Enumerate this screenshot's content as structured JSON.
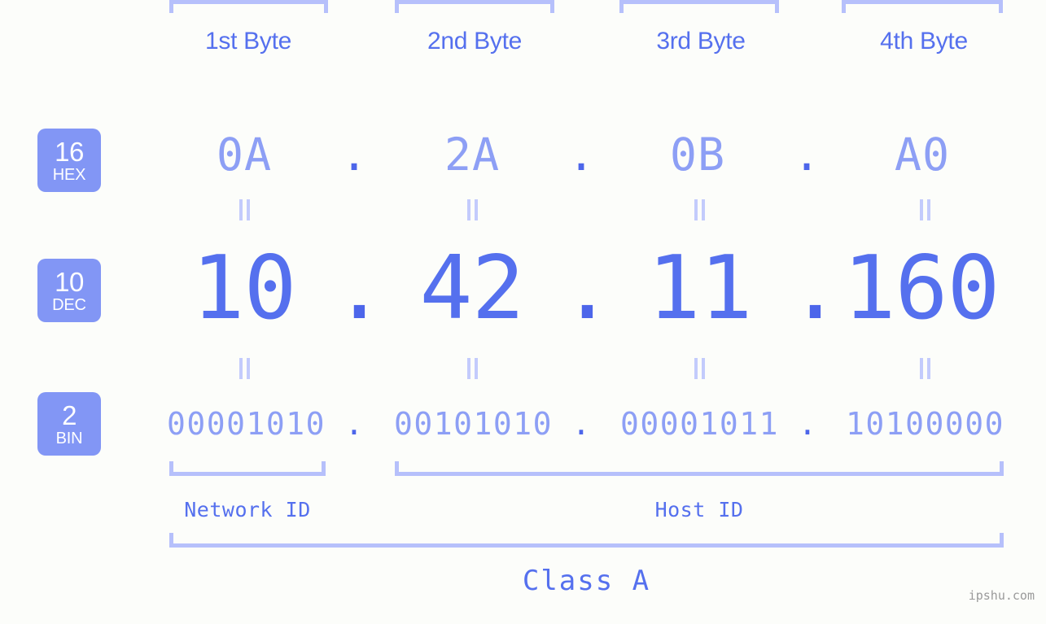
{
  "background_color": "#fcfdfa",
  "accent_color": "#5570ee",
  "accent_light_color": "#8d9ff5",
  "bracket_color": "#b6c0fb",
  "badge_color": "#8296f5",
  "header": {
    "byte_labels": [
      {
        "label": "1st Byte"
      },
      {
        "label": "2nd Byte"
      },
      {
        "label": "3rd Byte"
      },
      {
        "label": "4th Byte"
      }
    ]
  },
  "radix_badges": [
    {
      "number": "16",
      "system": "HEX"
    },
    {
      "number": "10",
      "system": "DEC"
    },
    {
      "number": "2",
      "system": "BIN"
    }
  ],
  "rows": {
    "hex": {
      "system": "HEX",
      "base": "16",
      "octets": [
        "0A",
        "2A",
        "0B",
        "A0"
      ],
      "separator": "."
    },
    "dec": {
      "system": "DEC",
      "base": "10",
      "octets": [
        "10",
        "42",
        "11",
        "160"
      ],
      "separator": "."
    },
    "bin": {
      "system": "BIN",
      "base": "2",
      "octets": [
        "00001010",
        "00101010",
        "00001011",
        "10100000"
      ],
      "separator": "."
    }
  },
  "equality_symbol": "=",
  "segments": {
    "network_id": {
      "label": "Network ID"
    },
    "host_id": {
      "label": "Host ID"
    }
  },
  "class": {
    "label": "Class A"
  },
  "watermark": {
    "text": "ipshu.com"
  }
}
